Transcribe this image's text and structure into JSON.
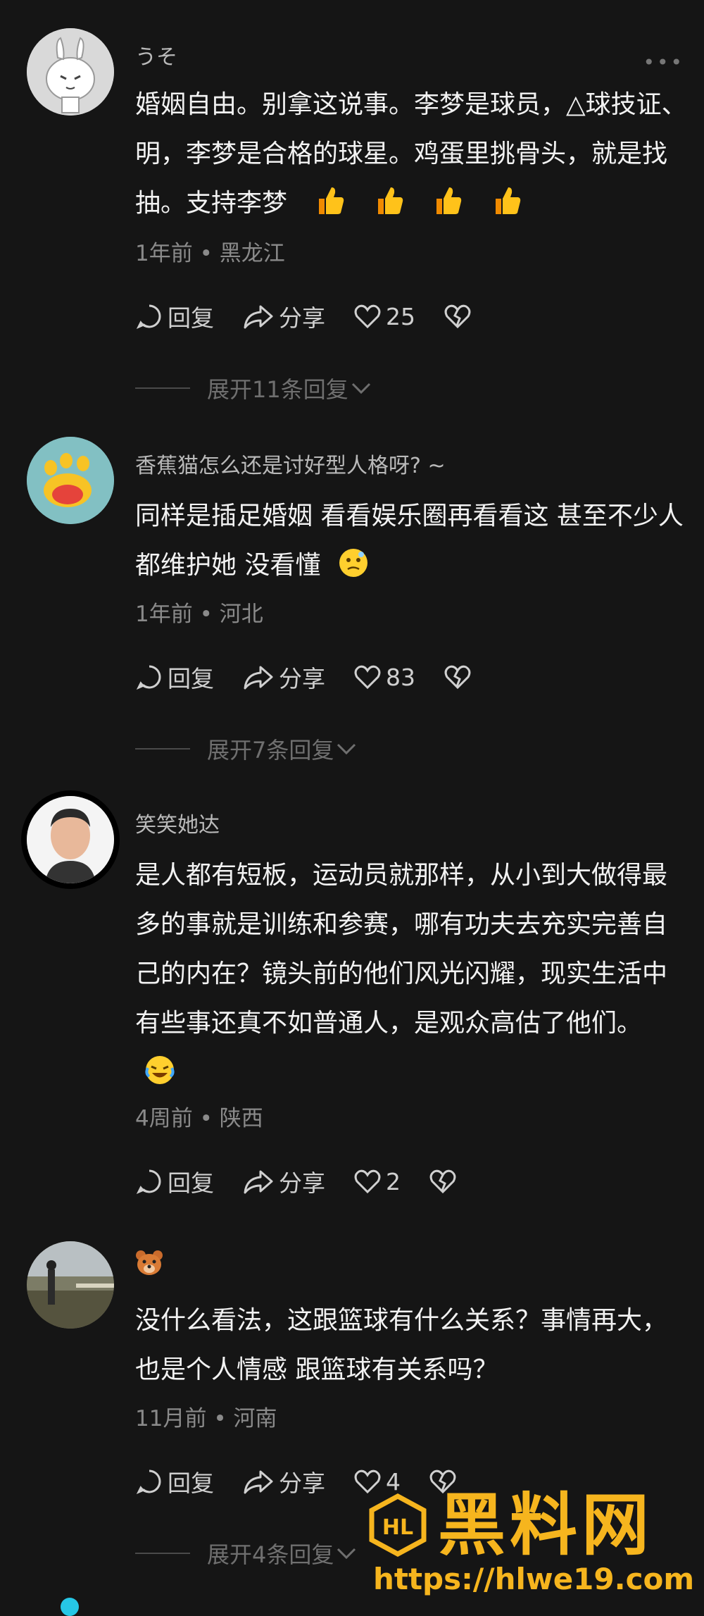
{
  "comments": [
    {
      "username": "うそ",
      "text": "婚姻自由。别拿这说事。李梦是球员，△球技证、明，李梦是合格的球星。鸡蛋里挑骨头，就是找抽。支持李梦",
      "time": "1年前",
      "location": "黑龙江",
      "reply_label": "回复",
      "share_label": "分享",
      "likes": "25",
      "expand_label": "展开11条回复"
    },
    {
      "username": "香蕉猫怎么还是讨好型人格呀? ~",
      "text": "同样是插足婚姻 看看娱乐圈再看看这 甚至不少人都维护她 没看懂",
      "time": "1年前",
      "location": "河北",
      "reply_label": "回复",
      "share_label": "分享",
      "likes": "83",
      "expand_label": "展开7条回复"
    },
    {
      "username": "笑笑她达",
      "text": "是人都有短板，运动员就那样，从小到大做得最多的事就是训练和参赛，哪有功夫去充实完善自己的内在？镜头前的他们风光闪耀，现实生活中有些事还真不如普通人，是观众高估了他们。",
      "time": "4周前",
      "location": "陕西",
      "reply_label": "回复",
      "share_label": "分享",
      "likes": "2"
    },
    {
      "username": "",
      "text": "没什么看法，这跟篮球有什么关系？事情再大，也是个人情感 跟篮球有关系吗？",
      "time": "11月前",
      "location": "河南",
      "reply_label": "回复",
      "share_label": "分享",
      "likes": "4",
      "expand_label": "展开4条回复"
    }
  ],
  "meta_separator": "•",
  "watermark": {
    "title": "黑料网",
    "url": "https://hlwe19.com",
    "logo_text": "HL"
  },
  "colors": {
    "background": "#151515",
    "watermark": "#f6b51e"
  }
}
